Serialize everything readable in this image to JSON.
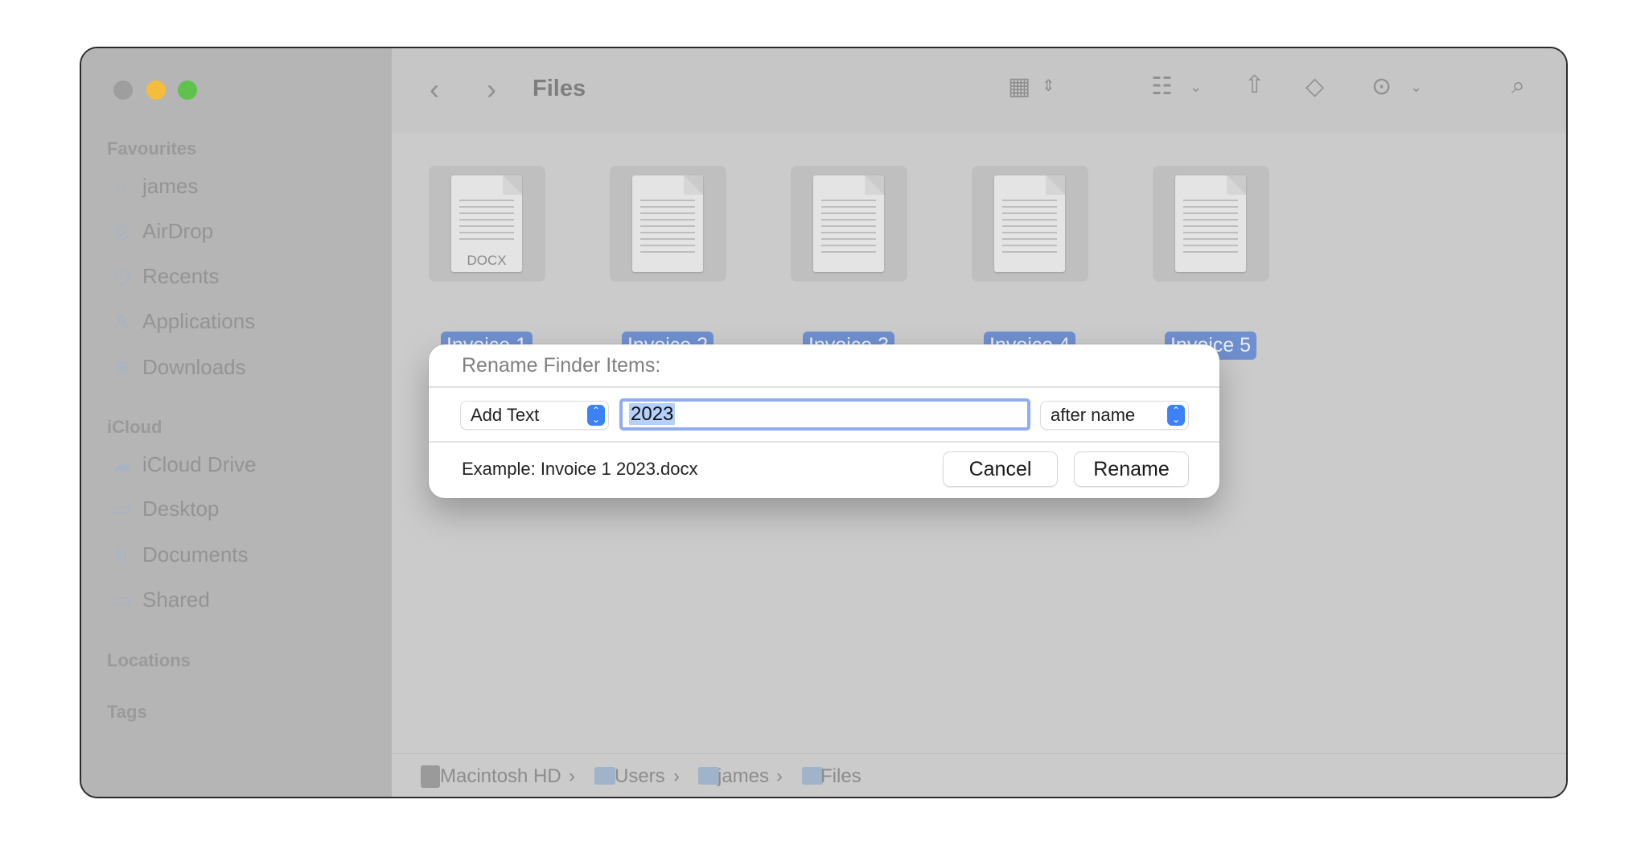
{
  "window": {
    "title": "Files"
  },
  "sidebar": {
    "sections": [
      {
        "label": "Favourites",
        "items": [
          {
            "label": "james",
            "icon": "house-icon"
          },
          {
            "label": "AirDrop",
            "icon": "airdrop-icon"
          },
          {
            "label": "Recents",
            "icon": "clock-icon"
          },
          {
            "label": "Applications",
            "icon": "applications-icon"
          },
          {
            "label": "Downloads",
            "icon": "download-icon"
          }
        ]
      },
      {
        "label": "iCloud",
        "items": [
          {
            "label": "iCloud Drive",
            "icon": "cloud-icon"
          },
          {
            "label": "Desktop",
            "icon": "desktop-icon"
          },
          {
            "label": "Documents",
            "icon": "document-icon"
          },
          {
            "label": "Shared",
            "icon": "shared-folder-icon"
          }
        ]
      },
      {
        "label": "Locations",
        "items": []
      },
      {
        "label": "Tags",
        "items": []
      }
    ]
  },
  "files": [
    {
      "name": "Invoice 1",
      "type": "DOCX"
    },
    {
      "name": "Invoice 2"
    },
    {
      "name": "Invoice 3"
    },
    {
      "name": "Invoice 4"
    },
    {
      "name": "Invoice 5"
    }
  ],
  "dialog": {
    "title": "Rename Finder Items:",
    "mode": "Add Text",
    "text_value": "2023",
    "position": "after name",
    "example": "Example: Invoice 1 2023.docx",
    "cancel": "Cancel",
    "rename": "Rename"
  },
  "path": [
    "Macintosh HD",
    "Users",
    "james",
    "Files"
  ],
  "colors": {
    "accent": "#3b82f6",
    "selection": "#6f8fcf",
    "close": "#9e9e9e",
    "minimize": "#f4bd3c",
    "zoom": "#5ec24d"
  }
}
